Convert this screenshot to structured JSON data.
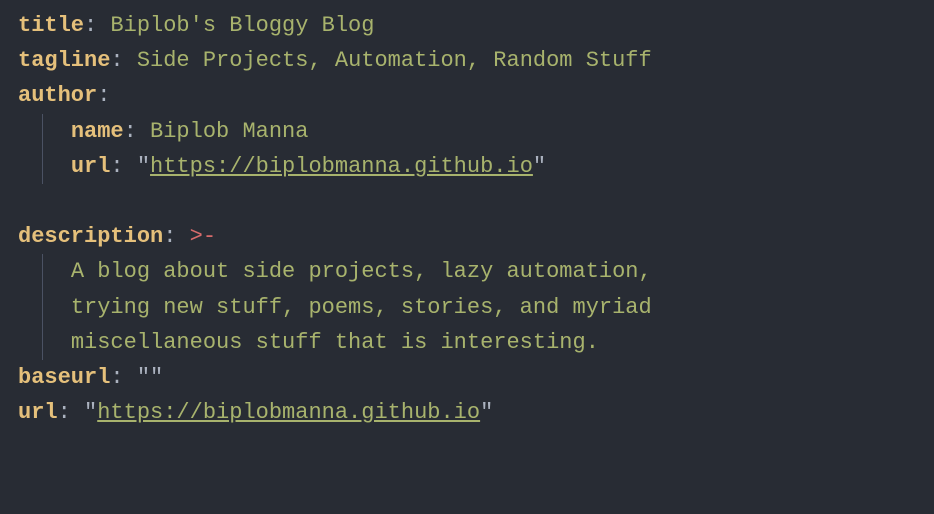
{
  "yaml": {
    "title_key": "title",
    "title_value": "Biplob's Bloggy Blog",
    "tagline_key": "tagline",
    "tagline_value": "Side Projects, Automation, Random Stuff",
    "author_key": "author",
    "author_name_key": "name",
    "author_name_value": "Biplob Manna",
    "author_url_key": "url",
    "author_url_value": "https://biplobmanna.github.io",
    "description_key": "description",
    "block_scalar_indicator": ">-",
    "description_line1": "A blog about side projects, lazy automation,",
    "description_line2": "trying new stuff, poems, stories, and myriad",
    "description_line3": "miscellaneous stuff that is interesting.",
    "baseurl_key": "baseurl",
    "baseurl_value": "",
    "url_key": "url",
    "url_value": "https://biplobmanna.github.io"
  }
}
